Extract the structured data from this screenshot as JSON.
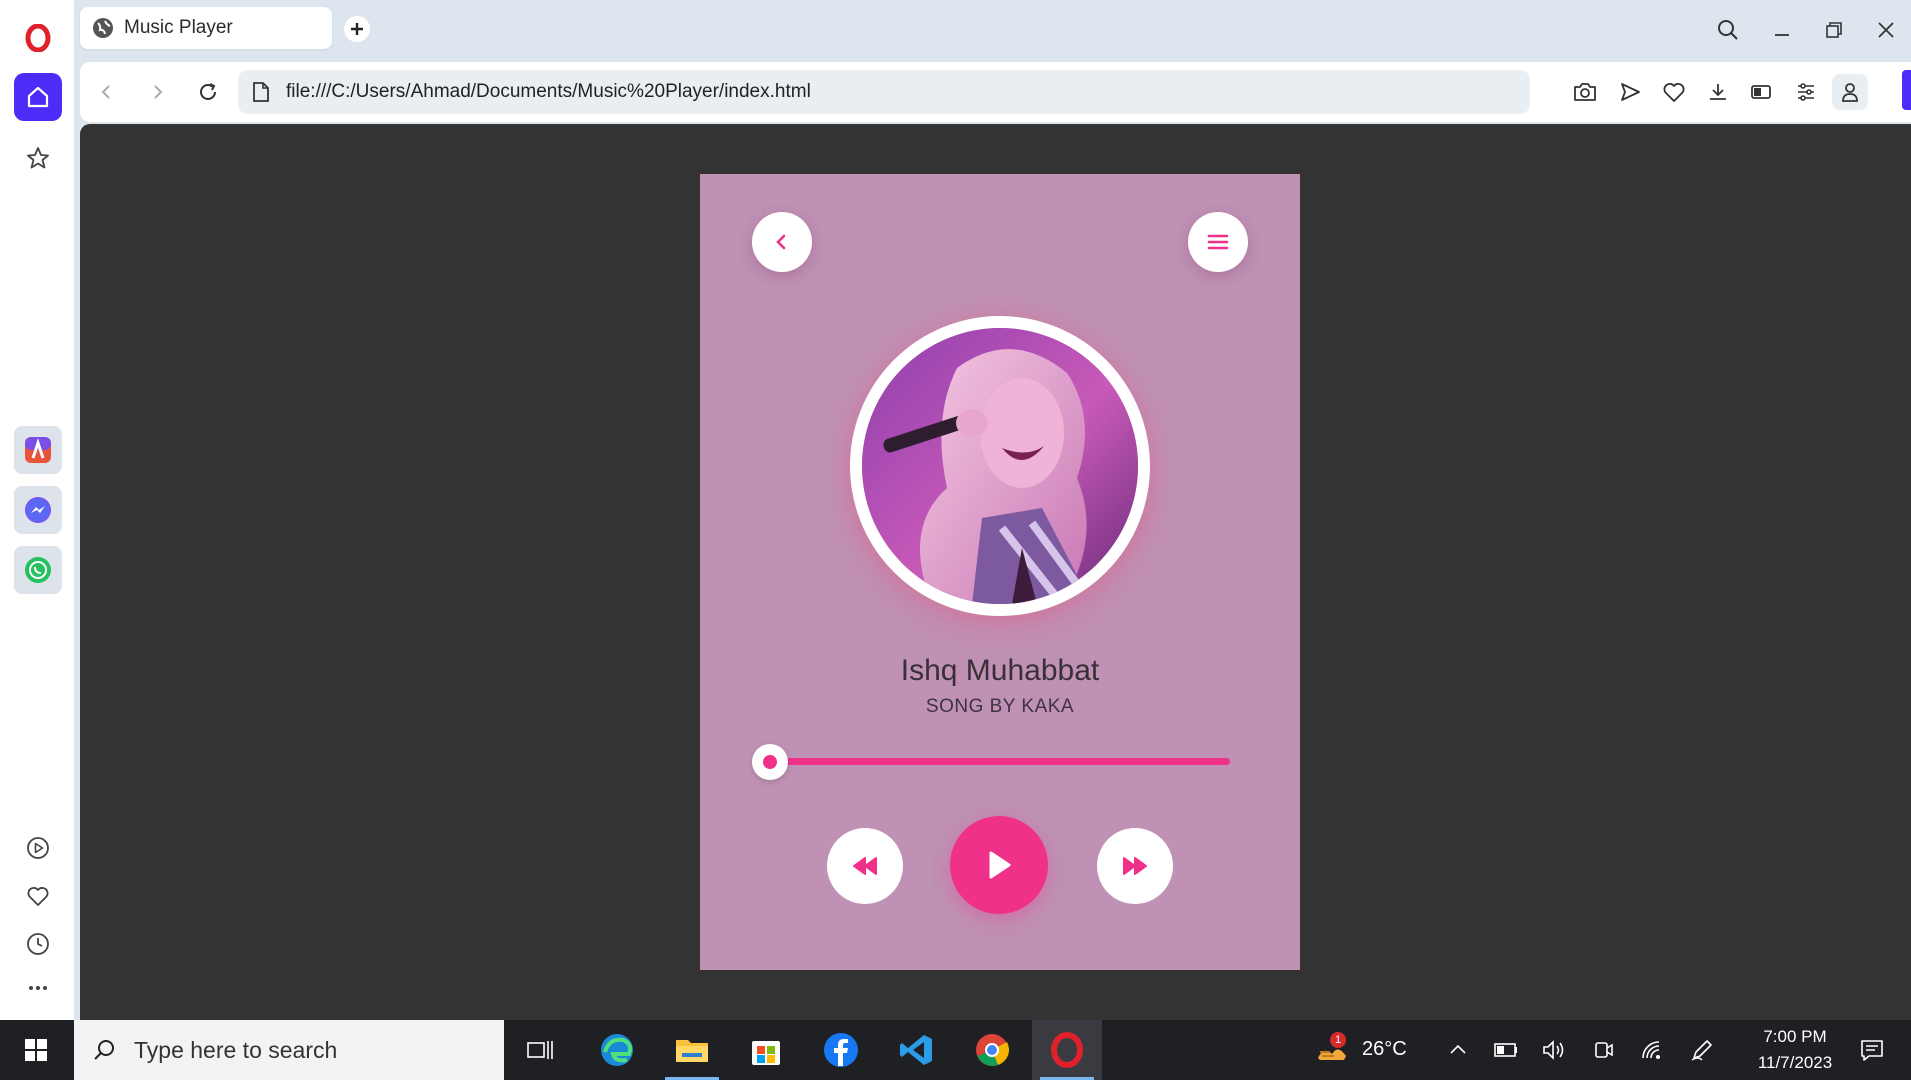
{
  "browser": {
    "tab_title": "Music Player",
    "url": "file:///C:/Users/Ahmad/Documents/Music%20Player/index.html"
  },
  "player": {
    "song_title": "Ishq Muhabbat",
    "song_artist": "SONG BY KAKA",
    "progress_fraction": 0.0,
    "accent_color": "#f0318a",
    "card_color": "#bf91b4"
  },
  "taskbar": {
    "search_placeholder": "Type here to search",
    "temperature": "26°C",
    "weather_badge": "1",
    "time": "7:00 PM",
    "date": "11/7/2023"
  }
}
